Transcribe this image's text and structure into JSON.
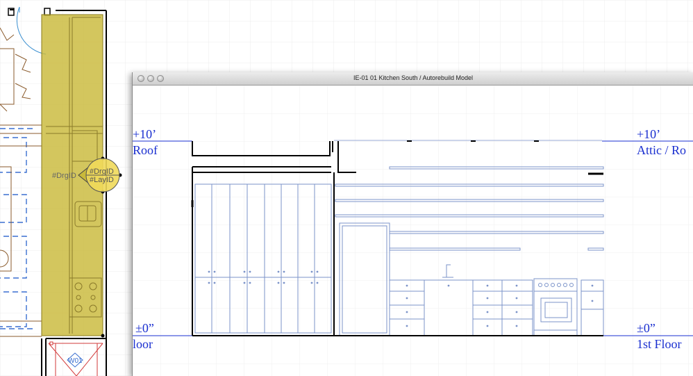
{
  "plan": {
    "drgid_label_left": "#DrgID",
    "marker_drgid": "#DrgID",
    "marker_layid": "#LayID",
    "window_tag": "W01"
  },
  "window": {
    "title": "IE-01 01 Kitchen South / Autorebuild Model"
  },
  "levels": {
    "top_left_elev": "+10’",
    "top_left_name": "Roof",
    "top_right_elev": "+10’",
    "top_right_name": "Attic / Ro",
    "bottom_left_elev": "±0”",
    "bottom_left_name": "loor",
    "bottom_right_elev": "±0”",
    "bottom_right_name": "1st Floor"
  },
  "colors": {
    "selection_fill": "#c9b93a",
    "level_blue": "#1a2fd0",
    "plan_brown": "#8a5a2b",
    "plan_blue_dash": "#3a6fd0",
    "elevation_blue": "#7b93c9"
  }
}
